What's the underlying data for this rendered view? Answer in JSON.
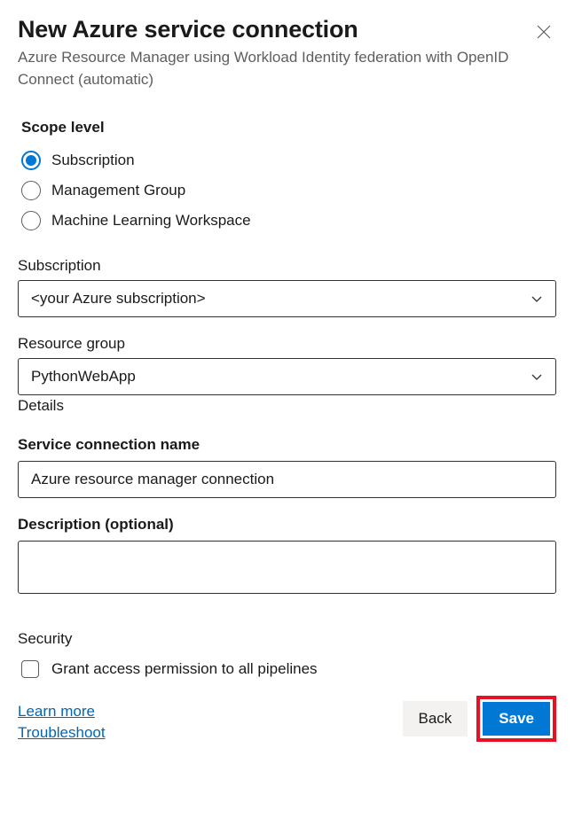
{
  "header": {
    "title": "New Azure service connection",
    "subtitle": "Azure Resource Manager using Workload Identity federation with OpenID Connect (automatic)"
  },
  "scope": {
    "label": "Scope level",
    "options": [
      {
        "label": "Subscription",
        "selected": true
      },
      {
        "label": "Management Group",
        "selected": false
      },
      {
        "label": "Machine Learning Workspace",
        "selected": false
      }
    ]
  },
  "subscription": {
    "label": "Subscription",
    "value": "<your Azure subscription>"
  },
  "resource_group": {
    "label": "Resource group",
    "value": "PythonWebApp",
    "helper": "Details"
  },
  "service_connection": {
    "label": "Service connection name",
    "value": "Azure resource manager connection"
  },
  "description": {
    "label": "Description (optional)",
    "value": ""
  },
  "security": {
    "label": "Security",
    "checkbox_label": "Grant access permission to all pipelines",
    "checked": false
  },
  "links": {
    "learn_more": "Learn more",
    "troubleshoot": "Troubleshoot"
  },
  "buttons": {
    "back": "Back",
    "save": "Save"
  }
}
